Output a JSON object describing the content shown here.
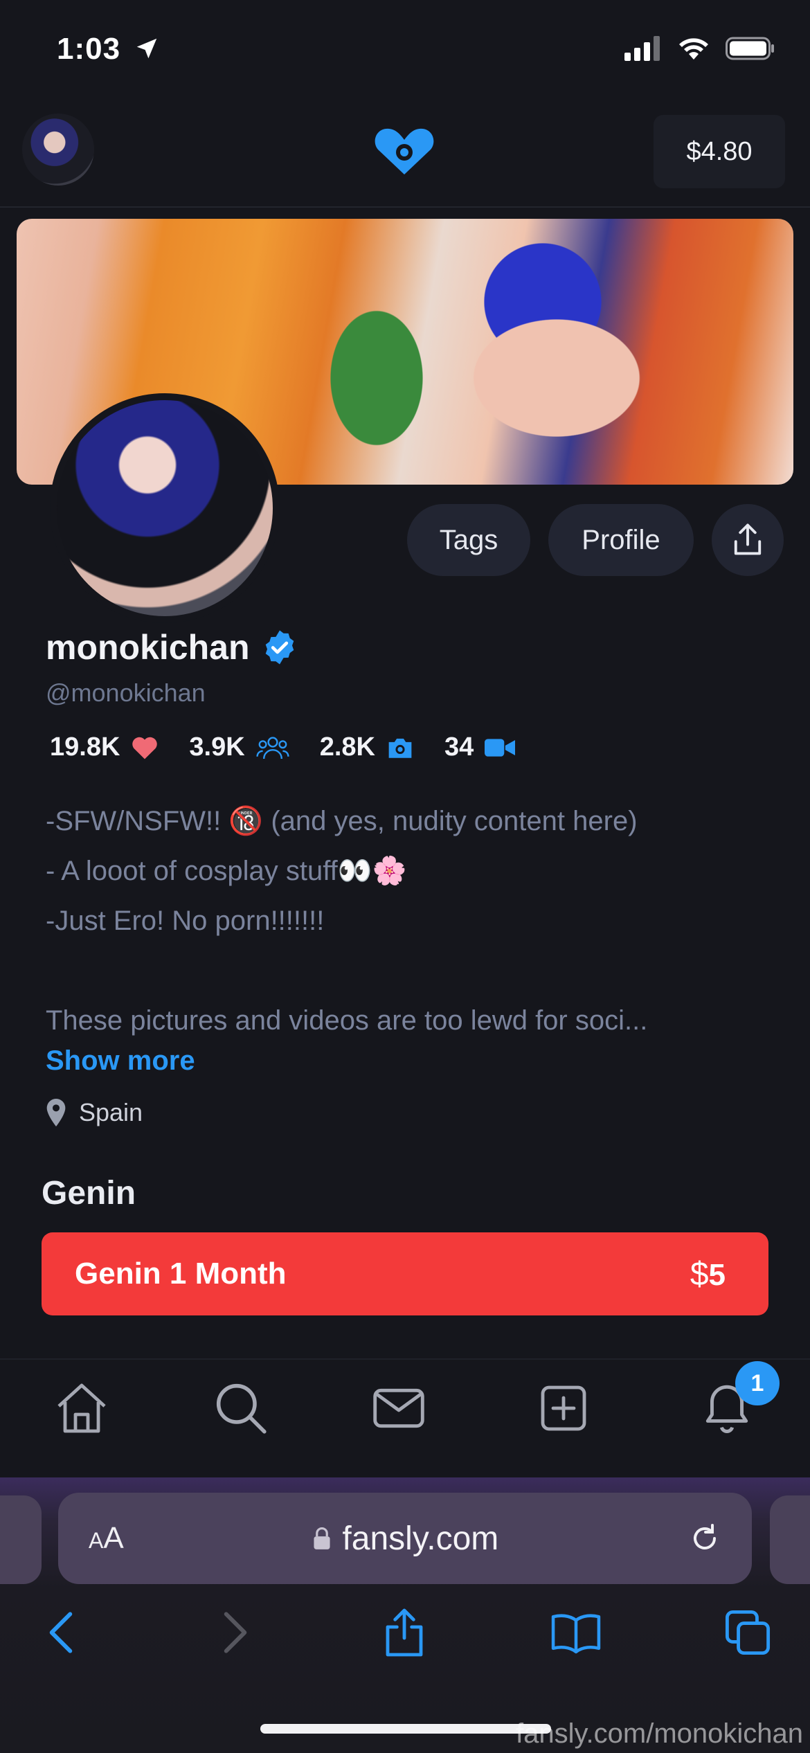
{
  "status_bar": {
    "time": "1:03",
    "icons": [
      "location-arrow-icon",
      "signal-icon",
      "wifi-icon",
      "battery-icon"
    ]
  },
  "header": {
    "balance": "$4.80",
    "logo_icon": "fansly-heart-logo-icon"
  },
  "profile": {
    "actions": {
      "tags": "Tags",
      "profile": "Profile",
      "share_icon": "share-icon"
    },
    "display_name": "monokichan",
    "verified_icon": "verified-badge-icon",
    "handle": "@monokichan",
    "stats": [
      {
        "value": "19.8K",
        "icon": "heart-icon"
      },
      {
        "value": "3.9K",
        "icon": "followers-icon"
      },
      {
        "value": "2.8K",
        "icon": "camera-icon"
      },
      {
        "value": "34",
        "icon": "video-icon"
      }
    ],
    "bio": {
      "line1": "-SFW/NSFW!! 🔞 (and yes, nudity content here)",
      "line2": "- A looot of cosplay stuff👀🌸",
      "line3": "-Just Ero! No porn!!!!!!!",
      "line4": "These pictures and videos are too lewd for soci..."
    },
    "show_more": "Show more",
    "location": "Spain"
  },
  "subscription": {
    "heading": "Genin",
    "tier_label": "Genin 1 Month",
    "currency": "$",
    "price": "5"
  },
  "bottom_nav": {
    "items": [
      "home-icon",
      "search-icon",
      "messages-icon",
      "create-post-icon",
      "notifications-icon"
    ],
    "notification_count": "1"
  },
  "browser": {
    "text_size": {
      "small": "A",
      "large": "A"
    },
    "url": "fansly.com",
    "controls": [
      "back-icon",
      "forward-icon",
      "share-icon",
      "bookmarks-icon",
      "tabs-icon"
    ]
  },
  "watermark": "fansly.com/monokichan",
  "colors": {
    "accent": "#2a98f5",
    "tier_button": "#f33a3a",
    "background": "#15161c"
  }
}
